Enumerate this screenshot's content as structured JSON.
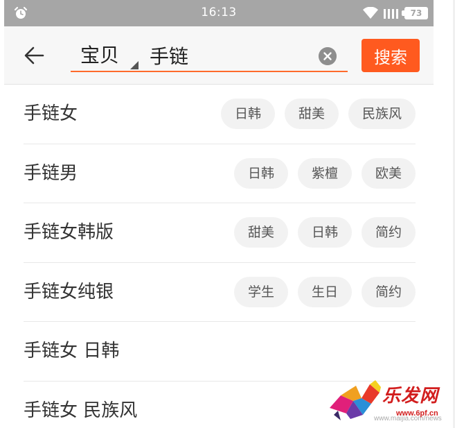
{
  "status_bar": {
    "time": "16:13",
    "battery": "73",
    "icons": [
      "alarm-icon",
      "wifi-icon",
      "signal-icon",
      "battery-icon"
    ]
  },
  "search": {
    "scope": "宝贝",
    "query": "手链",
    "button_label": "搜索",
    "icons": [
      "back-arrow-icon",
      "clear-icon",
      "dropdown-caret-icon"
    ],
    "accent_color": "#ff5a1f"
  },
  "suggestions": [
    {
      "text": "手链女",
      "tags": [
        "日韩",
        "甜美",
        "民族风"
      ]
    },
    {
      "text": "手链男",
      "tags": [
        "日韩",
        "紫檀",
        "欧美"
      ]
    },
    {
      "text": "手链女韩版",
      "tags": [
        "甜美",
        "日韩",
        "简约"
      ]
    },
    {
      "text": "手链女纯银",
      "tags": [
        "学生",
        "生日",
        "简约"
      ]
    },
    {
      "text": "手链女 日韩",
      "tags": []
    },
    {
      "text": "手链女 民族风",
      "tags": []
    }
  ],
  "watermark": {
    "brand": "乐发网",
    "url": "www.6pf.cn",
    "faint_text": "www.maijia.com/news"
  }
}
